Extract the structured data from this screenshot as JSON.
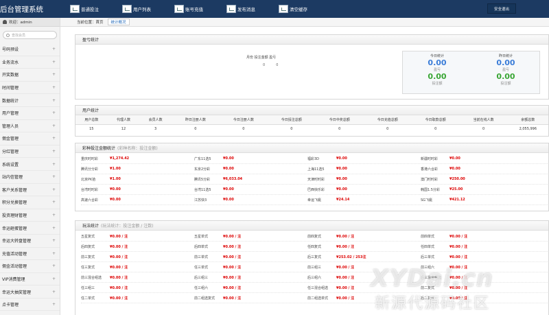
{
  "header": {
    "brand": "后台管理系统",
    "nav": [
      {
        "label": "普通投注",
        "icon": "chart-icon"
      },
      {
        "label": "用户列表",
        "icon": "chart-icon"
      },
      {
        "label": "账号充值",
        "icon": "chart-icon"
      },
      {
        "label": "发布消息",
        "icon": "chart-icon"
      },
      {
        "label": "清空缓存",
        "icon": "chart-icon"
      }
    ],
    "logout": "安全退出"
  },
  "sidebar": {
    "welcome": "欢迎：admin",
    "search_placeholder": "查找会员",
    "items": [
      "号码预设",
      "业务流水",
      "开奖数据",
      "时间管理",
      "数据统计",
      "用户管理",
      "管理人员",
      "佣金管理",
      "分红管理",
      "系统设置",
      "站内信管理",
      "客户关系管理",
      "积分兑换管理",
      "投资理财管理",
      "幸运砸蛋管理",
      "幸运大转盘管理",
      "充值活动管理",
      "佣金活动管理",
      "VIP消费管理",
      "幸运大抽奖管理",
      "点卡管理"
    ],
    "plus": "+"
  },
  "breadcrumb": {
    "prefix": "当前位置：首页",
    "current": "统计概况"
  },
  "profit": {
    "title": "盈亏统计",
    "center_label": "月份 投注金额 盈亏",
    "center_values": [
      "0",
      "0"
    ],
    "today": {
      "label": "今日统计",
      "profit": "0.00",
      "profit_label": "盈亏",
      "bet": "0.00",
      "bet_label": "投注额"
    },
    "yesterday": {
      "label": "昨日统计",
      "profit": "0.00",
      "profit_label": "盈亏",
      "bet": "0.00",
      "bet_label": "投注额"
    }
  },
  "users": {
    "title": "用户统计",
    "headers": [
      "用户总数",
      "代理人数",
      "会员人数",
      "昨日注册人数",
      "今日注册人数",
      "今日投注总额",
      "今日中奖总额",
      "今日充值总额",
      "今日取款总额",
      "当前在线人数",
      "余额总数"
    ],
    "values": [
      "15",
      "12",
      "3",
      "0",
      "0",
      "0",
      "0",
      "0",
      "0",
      "0",
      "2,055,996"
    ]
  },
  "lottery": {
    "title": "彩种投注金额统计",
    "subtitle": "(彩种名称：投注金额)",
    "rows": [
      [
        [
          "重庆时时彩",
          "¥1,274.42"
        ],
        [
          "广东11选5",
          "¥0.00"
        ],
        [
          "福彩3D",
          "¥0.00"
        ],
        [
          "新疆时时彩",
          "¥0.00"
        ]
      ],
      [
        [
          "腾讯分分彩",
          "¥1.00"
        ],
        [
          "东京2分彩",
          "¥0.00"
        ],
        [
          "上海11选5",
          "¥0.00"
        ],
        [
          "香港六合彩",
          "¥0.00"
        ]
      ],
      [
        [
          "北京PK拾",
          "¥1.00"
        ],
        [
          "腾讯5分彩",
          "¥6,033.04"
        ],
        [
          "天津时时彩",
          "¥0.00"
        ],
        [
          "澳门时时彩",
          "¥250.00"
        ]
      ],
      [
        [
          "台湾时时彩",
          "¥0.00"
        ],
        [
          "台湾11选5",
          "¥0.00"
        ],
        [
          "巴西快乐彩",
          "¥0.00"
        ],
        [
          "韩国1.5分彩",
          "¥25.00"
        ]
      ],
      [
        [
          "高速六合彩",
          "¥0.00"
        ],
        [
          "江苏快3",
          "¥0.00"
        ],
        [
          "幸运飞艇",
          "¥24.14"
        ],
        [
          "SG飞艇",
          "¥421.12"
        ]
      ]
    ]
  },
  "plays": {
    "title": "玩法统计",
    "subtitle": "(玩法统计：投注金额 / 注数)",
    "rows": [
      [
        [
          "五星复式",
          "¥0.00 / 注"
        ],
        [
          "五星单式",
          "¥0.00 / 注"
        ],
        [
          "前四复式",
          "¥0.00 / 注"
        ],
        [
          "前四单式",
          "¥0.00 / 注"
        ]
      ],
      [
        [
          "后四复式",
          "¥0.00 / 注"
        ],
        [
          "后四单式",
          "¥0.00 / 注"
        ],
        [
          "任四复式",
          "¥0.00 / 注"
        ],
        [
          "任四单式",
          "¥0.00 / 注"
        ]
      ],
      [
        [
          "前三复式",
          "¥0.00 / 注"
        ],
        [
          "前三单式",
          "¥0.00 / 注"
        ],
        [
          "后三复式",
          "¥253.02 / 253注"
        ],
        [
          "后三单式",
          "¥0.00 / 注"
        ]
      ],
      [
        [
          "任三复式",
          "¥0.00 / 注"
        ],
        [
          "任三单式",
          "¥0.00 / 注"
        ],
        [
          "前三组三",
          "¥0.00 / 注"
        ],
        [
          "前三组六",
          "¥0.00 / 注"
        ]
      ],
      [
        [
          "前三混合组选",
          "¥0.00 / 注"
        ],
        [
          "后三组三",
          "¥0.00 / 注"
        ],
        [
          "后三组六",
          "¥0.00 / 注"
        ],
        [
          "后三混合组选",
          "¥0.00 / 注"
        ]
      ],
      [
        [
          "任三组三",
          "¥0.00 / 注"
        ],
        [
          "任三组六",
          "¥0.00 / 注"
        ],
        [
          "任三混合组选",
          "¥0.00 / 注"
        ],
        [
          "前二复式",
          "¥0.00 / 注"
        ]
      ],
      [
        [
          "任二单式",
          "¥0.00 / 注"
        ],
        [
          "前二组选复式",
          "¥0.00 / 注"
        ],
        [
          "前二组选单式",
          "¥0.00 / 注"
        ],
        [
          "后二复式",
          "¥0.00 / 注"
        ]
      ]
    ]
  },
  "watermark": {
    "top": "XYDai.cn",
    "bottom": "新源代源码社区"
  }
}
